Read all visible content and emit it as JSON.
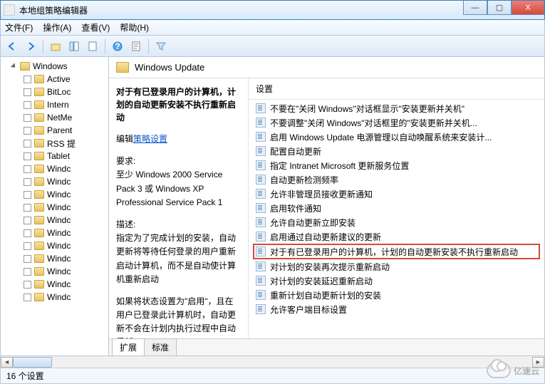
{
  "window": {
    "title": "本地组策略编辑器"
  },
  "win_buttons": {
    "min": "—",
    "max": "▢",
    "close": "X"
  },
  "menu": {
    "file": "文件(F)",
    "action": "操作(A)",
    "view": "查看(V)",
    "help": "帮助(H)"
  },
  "tree": {
    "top": "Windows",
    "items": [
      "Active",
      "BitLoc",
      "Intern",
      "NetMe",
      "Parent",
      "RSS 提",
      "Tablet",
      "Windc",
      "Windc",
      "Windc",
      "Windc",
      "Windc",
      "Windc",
      "Windc",
      "Windc",
      "Windc",
      "Windc",
      "Windc"
    ]
  },
  "header": {
    "title": "Windows Update"
  },
  "detail": {
    "policy_title": "对于有已登录用户的计算机，计划的自动更新安装不执行重新启动",
    "edit_label": "编辑",
    "edit_link": "策略设置",
    "req_label": "要求:",
    "req_body": "至少 Windows 2000 Service Pack 3 或 Windows XP Professional Service Pack 1",
    "desc_label": "描述:",
    "desc_body1": "指定为了完成计划的安装，自动更新将等待任何登录的用户重新启动计算机，而不是自动使计算机重新启动",
    "desc_body2": "如果将状态设置为\"启用\"，且在用户已登录此计算机时，自动更新不会在计划内执行过程中自动重新"
  },
  "settings": {
    "column": "设置",
    "items": [
      "不要在\"关闭 Windows\"对话框显示\"安装更新并关机\"",
      "不要调整\"关闭 Windows\"对话框里的\"安装更新并关机...",
      "启用 Windows Update 电源管理以自动唤醒系统来安装计...",
      "配置自动更新",
      "指定 Intranet Microsoft 更新服务位置",
      "自动更新检测频率",
      "允许非管理员接收更新通知",
      "启用软件通知",
      "允许自动更新立即安装",
      "启用通过自动更新建议的更新",
      "对于有已登录用户的计算机，计划的自动更新安装不执行重新启动",
      "对计划的安装再次提示重新启动",
      "对计划的安装延迟重新启动",
      "重新计划自动更新计划的安装",
      "允许客户端目标设置"
    ],
    "highlighted_index": 10
  },
  "tabs": {
    "extended": "扩展",
    "standard": "标准"
  },
  "status": {
    "count": "16 个设置"
  },
  "watermark": "亿速云"
}
